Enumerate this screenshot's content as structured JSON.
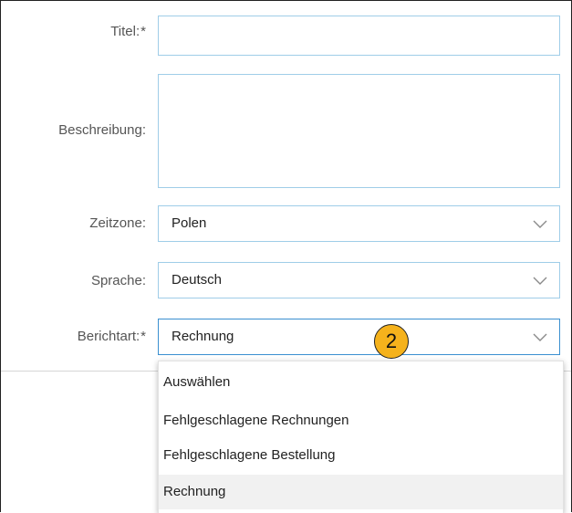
{
  "form": {
    "title": {
      "label": "Titel:",
      "required": "*",
      "value": ""
    },
    "description": {
      "label": "Beschreibung:",
      "value": ""
    },
    "timezone": {
      "label": "Zeitzone:",
      "value": "Polen"
    },
    "language": {
      "label": "Sprache:",
      "value": "Deutsch"
    },
    "report_type": {
      "label": "Berichtart:",
      "required": "*",
      "value": "Rechnung",
      "options": [
        {
          "label": "Auswählen"
        },
        {
          "label": "Fehlgeschlagene Rechnungen"
        },
        {
          "label": "Fehlgeschlagene Bestellung"
        },
        {
          "label": "Rechnung",
          "selected": true
        }
      ]
    }
  },
  "annotation": {
    "step": "2"
  },
  "colors": {
    "field_border": "#9fcde8",
    "active_border": "#3a8fd0",
    "marker_fill": "#f5b21c",
    "selected_option_bg": "#f1f1f1"
  },
  "icons": {
    "dropdown_toggle": "chevron-down-icon"
  }
}
